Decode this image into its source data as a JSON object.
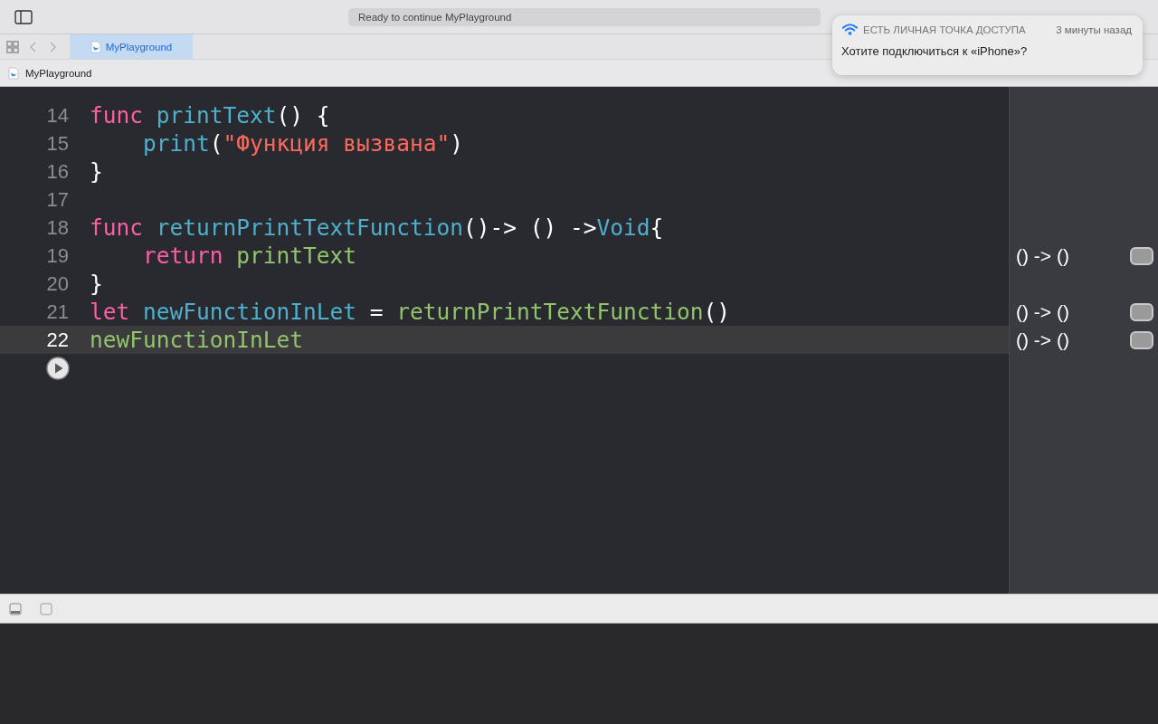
{
  "toolbar": {
    "status": "Ready to continue MyPlayground"
  },
  "tabs": [
    {
      "label": "MyPlayground",
      "selected": true
    }
  ],
  "breadcrumb": {
    "label": "MyPlayground"
  },
  "editor": {
    "lines": [
      {
        "number": "14",
        "current": false,
        "tokens": [
          {
            "kind": "keyword",
            "text": "func"
          },
          {
            "kind": "declaration",
            "text": " printText"
          },
          {
            "kind": "plain",
            "text": "() {"
          }
        ]
      },
      {
        "number": "15",
        "current": false,
        "tokens": [
          {
            "kind": "declaration",
            "text": "    print"
          },
          {
            "kind": "plain",
            "text": "("
          },
          {
            "kind": "string",
            "text": "\"Функция вызвана\""
          },
          {
            "kind": "plain",
            "text": ")"
          }
        ]
      },
      {
        "number": "16",
        "current": false,
        "tokens": [
          {
            "kind": "plain",
            "text": "}"
          }
        ]
      },
      {
        "number": "17",
        "current": false
      },
      {
        "number": "18",
        "current": false,
        "tokens": [
          {
            "kind": "keyword",
            "text": "func"
          },
          {
            "kind": "declaration",
            "text": " returnPrintTextFunction"
          },
          {
            "kind": "plain",
            "text": "()-> () ->"
          },
          {
            "kind": "declaration",
            "text": "Void"
          },
          {
            "kind": "plain",
            "text": "{"
          }
        ]
      },
      {
        "number": "19",
        "current": false,
        "result": "() -> ()",
        "tokens": [
          {
            "kind": "keyword",
            "text": "    return"
          },
          {
            "kind": "reference",
            "text": " printText"
          }
        ]
      },
      {
        "number": "20",
        "current": false,
        "tokens": [
          {
            "kind": "plain",
            "text": "}"
          }
        ]
      },
      {
        "number": "21",
        "current": false,
        "result": "() -> ()",
        "tokens": [
          {
            "kind": "keyword",
            "text": "let"
          },
          {
            "kind": "declaration",
            "text": " newFunctionInLet"
          },
          {
            "kind": "plain",
            "text": " = "
          },
          {
            "kind": "reference",
            "text": "returnPrintTextFunction"
          },
          {
            "kind": "plain",
            "text": "()"
          }
        ]
      },
      {
        "number": "22",
        "current": true,
        "result": "() -> ()",
        "tokens": [
          {
            "kind": "reference",
            "text": "newFunctionInLet"
          }
        ]
      }
    ]
  },
  "notification": {
    "title": "ЕСТЬ ЛИЧНАЯ ТОЧКА ДОСТУПА",
    "time": "3 минуты назад",
    "message": "Хотите подключиться к «iPhone»?"
  }
}
